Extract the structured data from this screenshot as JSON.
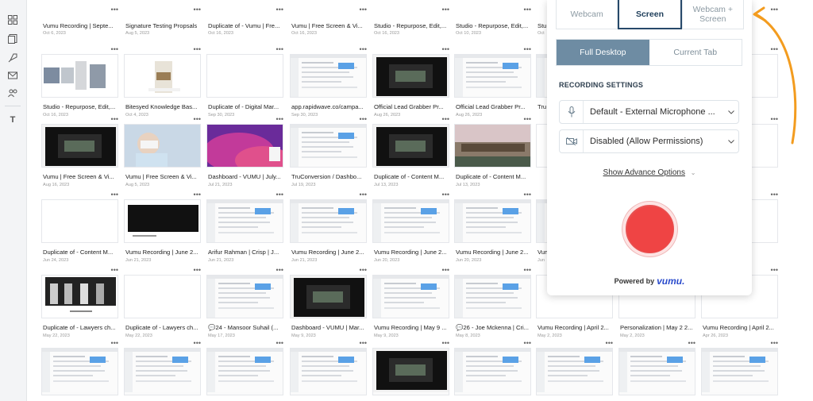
{
  "sidebar": {
    "icons": [
      "grid-icon",
      "document-icon",
      "rocket-icon",
      "mail-icon",
      "users-icon",
      "text-icon"
    ]
  },
  "rows": [
    {
      "kind": "top",
      "cards": [
        {
          "title": "Vumu Recording | Septe...",
          "date": "Oct 6, 2023",
          "thumb": "blank"
        },
        {
          "title": "Signature Testing Propsals",
          "date": "Aug 5, 2023",
          "thumb": "blank"
        },
        {
          "title": "Duplicate of - Vumu | Fre...",
          "date": "Oct 16, 2023",
          "thumb": "blank"
        },
        {
          "title": "Vumu | Free Screen & Vi...",
          "date": "Oct 16, 2023",
          "thumb": "blank"
        },
        {
          "title": "Studio - Repurpose, Edit,...",
          "date": "Oct 16, 2023",
          "thumb": "blank"
        },
        {
          "title": "Studio - Repurpose, Edit,...",
          "date": "Oct 10, 2023",
          "thumb": "blank"
        },
        {
          "title": "Stu",
          "date": "Oct",
          "thumb": "blank"
        },
        {
          "title": "",
          "date": "",
          "thumb": "blank"
        },
        {
          "title": "",
          "date": "",
          "thumb": "blank"
        }
      ]
    },
    {
      "kind": "below",
      "cards": [
        {
          "title": "Studio - Repurpose, Edit,...",
          "date": "Oct 16, 2023",
          "thumb": "screens"
        },
        {
          "title": "Bitesyed Knowledge Bas...",
          "date": "Oct 4, 2023",
          "thumb": "poster"
        },
        {
          "title": "Duplicate of - Digital Mar...",
          "date": "Sep 30, 2023",
          "thumb": "blank"
        },
        {
          "title": "app.rapidwave.co/campa...",
          "date": "Sep 30, 2023",
          "thumb": "ui"
        },
        {
          "title": "Official Lead Grabber Pr...",
          "date": "Aug 26, 2023",
          "thumb": "dark"
        },
        {
          "title": "Official Lead Grabber Pr...",
          "date": "Aug 26, 2023",
          "thumb": "ui"
        },
        {
          "title": "Tru",
          "date": "",
          "thumb": "ui"
        },
        {
          "title": "",
          "date": "",
          "thumb": "blank"
        },
        {
          "title": "gust",
          "date": "",
          "thumb": "blank"
        }
      ]
    },
    {
      "kind": "below",
      "cards": [
        {
          "title": "Vumu | Free Screen & Vi...",
          "date": "Aug 16, 2023",
          "thumb": "dark"
        },
        {
          "title": "Vumu | Free Screen & Vi...",
          "date": "Aug 5, 2023",
          "thumb": "vr"
        },
        {
          "title": "Dashboard - VUMU | July...",
          "date": "Jul 21, 2023",
          "thumb": "purple"
        },
        {
          "title": "TruConversion / Dashbo...",
          "date": "Jul 19, 2023",
          "thumb": "ui"
        },
        {
          "title": "Duplicate of - Content M...",
          "date": "Jul 13, 2023",
          "thumb": "dark"
        },
        {
          "title": "Duplicate of - Content M...",
          "date": "Jul 13, 2023",
          "thumb": "photo"
        },
        {
          "title": "",
          "date": "",
          "thumb": "blank"
        },
        {
          "title": "",
          "date": "",
          "thumb": "blank"
        },
        {
          "title": "",
          "date": "",
          "thumb": "blank"
        }
      ]
    },
    {
      "kind": "below",
      "cards": [
        {
          "title": "Duplicate of - Content M...",
          "date": "Jun 24, 2023",
          "thumb": "blank"
        },
        {
          "title": "Vumu Recording | June 2...",
          "date": "Jun 21, 2023",
          "thumb": "darkwide"
        },
        {
          "title": "Arifur Rahman | Crisp | J...",
          "date": "Jun 21, 2023",
          "thumb": "ui"
        },
        {
          "title": "Vumu Recording | June 2...",
          "date": "Jun 21, 2023",
          "thumb": "ui"
        },
        {
          "title": "Vumu Recording | June 2...",
          "date": "Jun 20, 2023",
          "thumb": "ui"
        },
        {
          "title": "Vumu Recording | June 2...",
          "date": "Jun 20, 2023",
          "thumb": "ui"
        },
        {
          "title": "Vum",
          "date": "Jun",
          "thumb": "ui"
        },
        {
          "title": "",
          "date": "",
          "thumb": "blank"
        },
        {
          "title": "Content M...",
          "date": "",
          "thumb": "blank"
        }
      ]
    },
    {
      "kind": "below",
      "cards": [
        {
          "title": "Duplicate of - Lawyers ch...",
          "date": "May 22, 2023",
          "thumb": "lawyers"
        },
        {
          "title": "Duplicate of - Lawyers ch...",
          "date": "May 22, 2023",
          "thumb": "blank"
        },
        {
          "title": "💬24 - Mansoor Suhail (...",
          "date": "May 17, 2023",
          "thumb": "ui"
        },
        {
          "title": "Dashboard - VUMU | Mar...",
          "date": "May 9, 2023",
          "thumb": "dark"
        },
        {
          "title": "Vumu Recording | May 9 ...",
          "date": "May 9, 2023",
          "thumb": "ui"
        },
        {
          "title": "💬26 - Joe Mckenna | Cri...",
          "date": "May 8, 2023",
          "thumb": "ui"
        },
        {
          "title": "Vumu Recording | April 2...",
          "date": "May 2, 2023",
          "thumb": "blank"
        },
        {
          "title": "Personalization | May 2 2...",
          "date": "May 2, 2023",
          "thumb": "blank"
        },
        {
          "title": "Vumu Recording | April 2...",
          "date": "Apr 26, 2023",
          "thumb": "blank"
        }
      ]
    },
    {
      "kind": "cut",
      "cards": [
        {
          "title": "",
          "date": "",
          "thumb": "ui"
        },
        {
          "title": "",
          "date": "",
          "thumb": "ui"
        },
        {
          "title": "",
          "date": "",
          "thumb": "ui"
        },
        {
          "title": "",
          "date": "",
          "thumb": "ui"
        },
        {
          "title": "",
          "date": "",
          "thumb": "dark"
        },
        {
          "title": "",
          "date": "",
          "thumb": "ui"
        },
        {
          "title": "",
          "date": "",
          "thumb": "ui"
        },
        {
          "title": "",
          "date": "",
          "thumb": "ui"
        },
        {
          "title": "",
          "date": "",
          "thumb": "ui"
        }
      ]
    }
  ],
  "popup": {
    "mode_tabs": [
      "Webcam",
      "Screen",
      "Webcam +\nScreen"
    ],
    "active_mode": 1,
    "view_tabs": [
      "Full Desktop",
      "Current Tab"
    ],
    "active_view": 0,
    "settings_label": "RECORDING SETTINGS",
    "microphone": "Default - External Microphone ...",
    "camera": "Disabled (Allow Permissions)",
    "advanced": "Show Advance Options",
    "powered_by": "Powered by",
    "logo": "vumu.",
    "colors": {
      "record": "#ef4444",
      "active_tab": "#6e8ca3",
      "arrow": "#f39c1f"
    }
  }
}
